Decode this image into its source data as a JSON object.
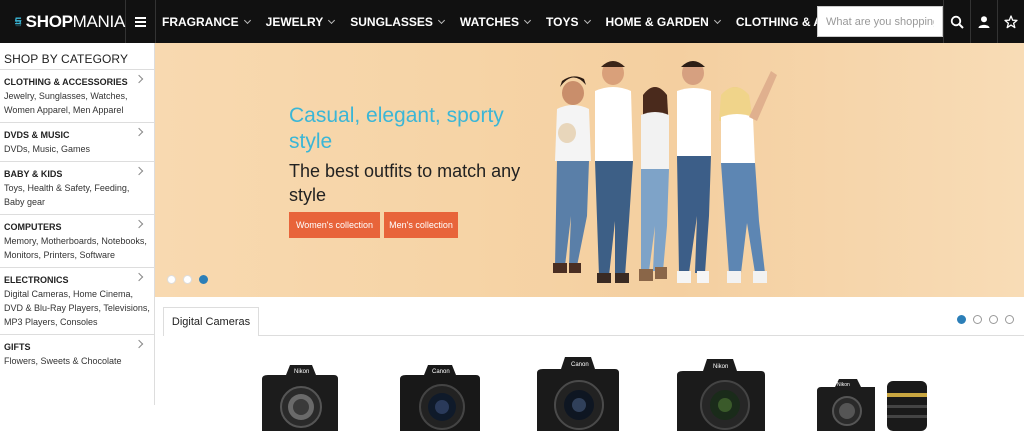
{
  "logo": {
    "bold": "SHOP",
    "light": "MANIA"
  },
  "nav": {
    "items": [
      {
        "label": "FRAGRANCE"
      },
      {
        "label": "JEWELRY"
      },
      {
        "label": "SUNGLASSES"
      },
      {
        "label": "WATCHES"
      },
      {
        "label": "TOYS"
      },
      {
        "label": "HOME & GARDEN"
      },
      {
        "label": "CLOTHING & ACCESSORIES"
      }
    ]
  },
  "search": {
    "placeholder": "What are you shopping f",
    "value": ""
  },
  "icons": {
    "menu": "hamburger-icon",
    "search": "search-icon",
    "account": "user-icon",
    "favorites": "star-icon"
  },
  "sidebar": {
    "title": "SHOP BY CATEGORY",
    "categories": [
      {
        "name": "CLOTHING & ACCESSORIES",
        "sub": "Jewelry, Sunglasses, Watches, Women Apparel, Men Apparel"
      },
      {
        "name": "DVDS & MUSIC",
        "sub": "DVDs, Music, Games"
      },
      {
        "name": "BABY & KIDS",
        "sub": "Toys, Health & Safety, Feeding, Baby gear"
      },
      {
        "name": "COMPUTERS",
        "sub": "Memory, Motherboards, Notebooks, Monitors, Printers, Software"
      },
      {
        "name": "ELECTRONICS",
        "sub": "Digital Cameras, Home Cinema, DVD & Blu-Ray Players, Televisions, MP3 Players, Consoles"
      },
      {
        "name": "GIFTS",
        "sub": "Flowers, Sweets & Chocolate"
      }
    ]
  },
  "banner": {
    "headline": "Casual, elegant, sporty style",
    "subheadline": "The best outfits to match any style",
    "btn_women": "Women's collection",
    "btn_men": "Men's collection",
    "slides": 3,
    "active_slide": 3
  },
  "products": {
    "tab": "Digital Cameras",
    "pages": 4,
    "active_page": 1,
    "brands": [
      "Nikon",
      "Canon",
      "Canon",
      "Nikon",
      "Nikon"
    ]
  },
  "colors": {
    "accent": "#3bb6d6",
    "button": "#e8643a",
    "topbar": "#111111",
    "dot_active": "#2c7fb8"
  }
}
